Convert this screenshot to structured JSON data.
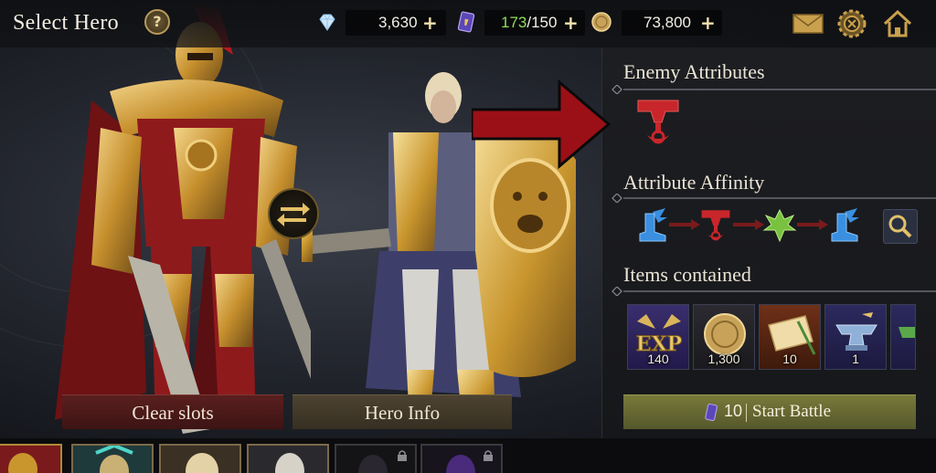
{
  "header": {
    "title": "Select Hero",
    "resources": [
      {
        "icon": "diamond-icon",
        "value": "3,630"
      },
      {
        "icon": "ticket-icon",
        "current": "173",
        "max": "/150"
      },
      {
        "icon": "coin-icon",
        "value": "73,800"
      }
    ],
    "buttons": [
      "mail-icon",
      "settings-gear-icon",
      "home-icon"
    ]
  },
  "actions": {
    "clear_slots": "Clear slots",
    "hero_info": "Hero Info"
  },
  "panel": {
    "enemy_attributes_title": "Enemy Attributes",
    "enemy_attribute_icon": "hammer-icon",
    "affinity_title": "Attribute Affinity",
    "affinity_chain": [
      "winged-boot-icon",
      "hammer-icon",
      "leaf-icon",
      "winged-boot-icon"
    ],
    "items_title": "Items contained",
    "items": [
      {
        "icon": "exp-icon",
        "qty": "140"
      },
      {
        "icon": "gold-coin-icon",
        "qty": "1,300"
      },
      {
        "icon": "scroll-icon",
        "qty": "10"
      },
      {
        "icon": "anvil-icon",
        "qty": "1"
      }
    ],
    "start_battle": {
      "cost": "10",
      "label": "Start Battle"
    }
  },
  "colors": {
    "attribute_red": "#c8262b",
    "attribute_blue": "#3a8fe0",
    "attribute_green": "#79c23f",
    "accent_gold": "#d9b45a",
    "annotation_arrow": "#9b1016"
  }
}
